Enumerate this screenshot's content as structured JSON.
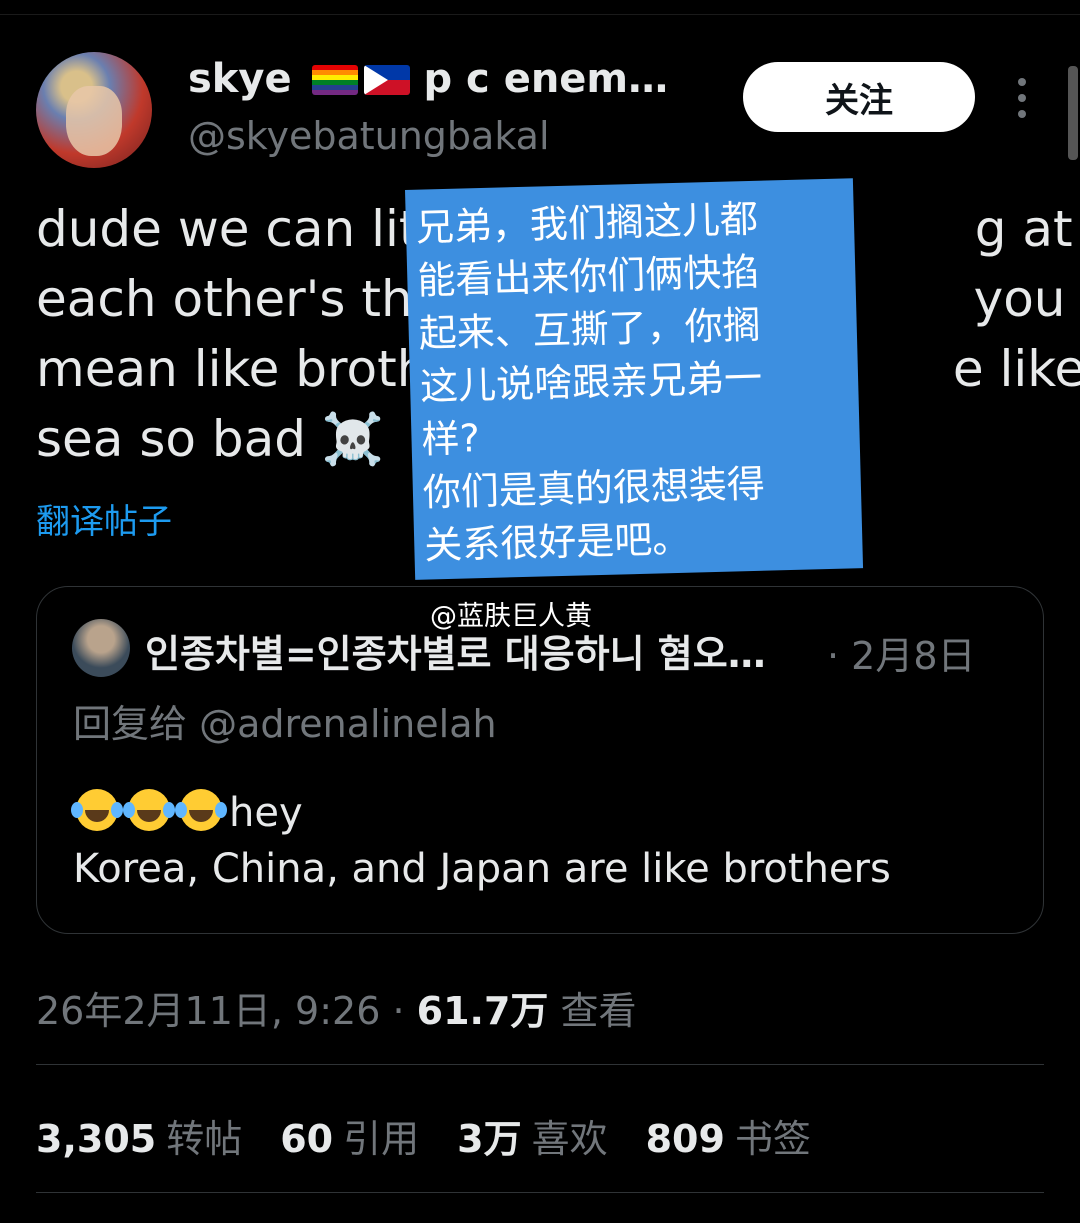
{
  "author": {
    "display_name": "skye",
    "name_tail": "p      c enem…",
    "handle": "@skyebatungbakal",
    "flags": [
      "rainbow-flag",
      "philippines-flag"
    ]
  },
  "follow_button": "关注",
  "tweet": {
    "lines": [
      "dude we can lit                                   g at",
      "each other's thr                                  you",
      "mean like broth                                 e like",
      "sea so bad ☠️"
    ],
    "translate_link": "翻译帖子"
  },
  "overlay": {
    "lines": [
      "兄弟，我们搁这儿都",
      "能看出来你们俩快掐",
      "起来、互撕了，你搁",
      "这儿说啥跟亲兄弟一",
      "样?",
      "你们是真的很想装得",
      "关系很好是吧。"
    ]
  },
  "watermark": "@蓝肤巨人黄",
  "quote": {
    "author_name": "인종차별=인종차별로 대응하니 혐오…",
    "date": "· 2月8日",
    "reply_prefix": "回复给",
    "reply_handle": "@adrenalinelah",
    "line1_text": "hey",
    "line2": "Korea, China, and Japan are like brothers",
    "emoji_icons": [
      "tears-of-joy-emoji",
      "tears-of-joy-emoji",
      "tears-of-joy-emoji"
    ]
  },
  "meta": {
    "timestamp": "26年2月11日, 9:26 · ",
    "views_count": "61.7万",
    "views_label": " 查看"
  },
  "stats": [
    {
      "count": "3,305",
      "label": "转帖"
    },
    {
      "count": "60",
      "label": "引用"
    },
    {
      "count": "3万",
      "label": "喜欢"
    },
    {
      "count": "809",
      "label": "书签"
    }
  ],
  "colors": {
    "background": "#000000",
    "text": "#e7e9ea",
    "secondary": "#71767b",
    "link": "#1d9bf0",
    "overlay": "#3d8fe0"
  }
}
